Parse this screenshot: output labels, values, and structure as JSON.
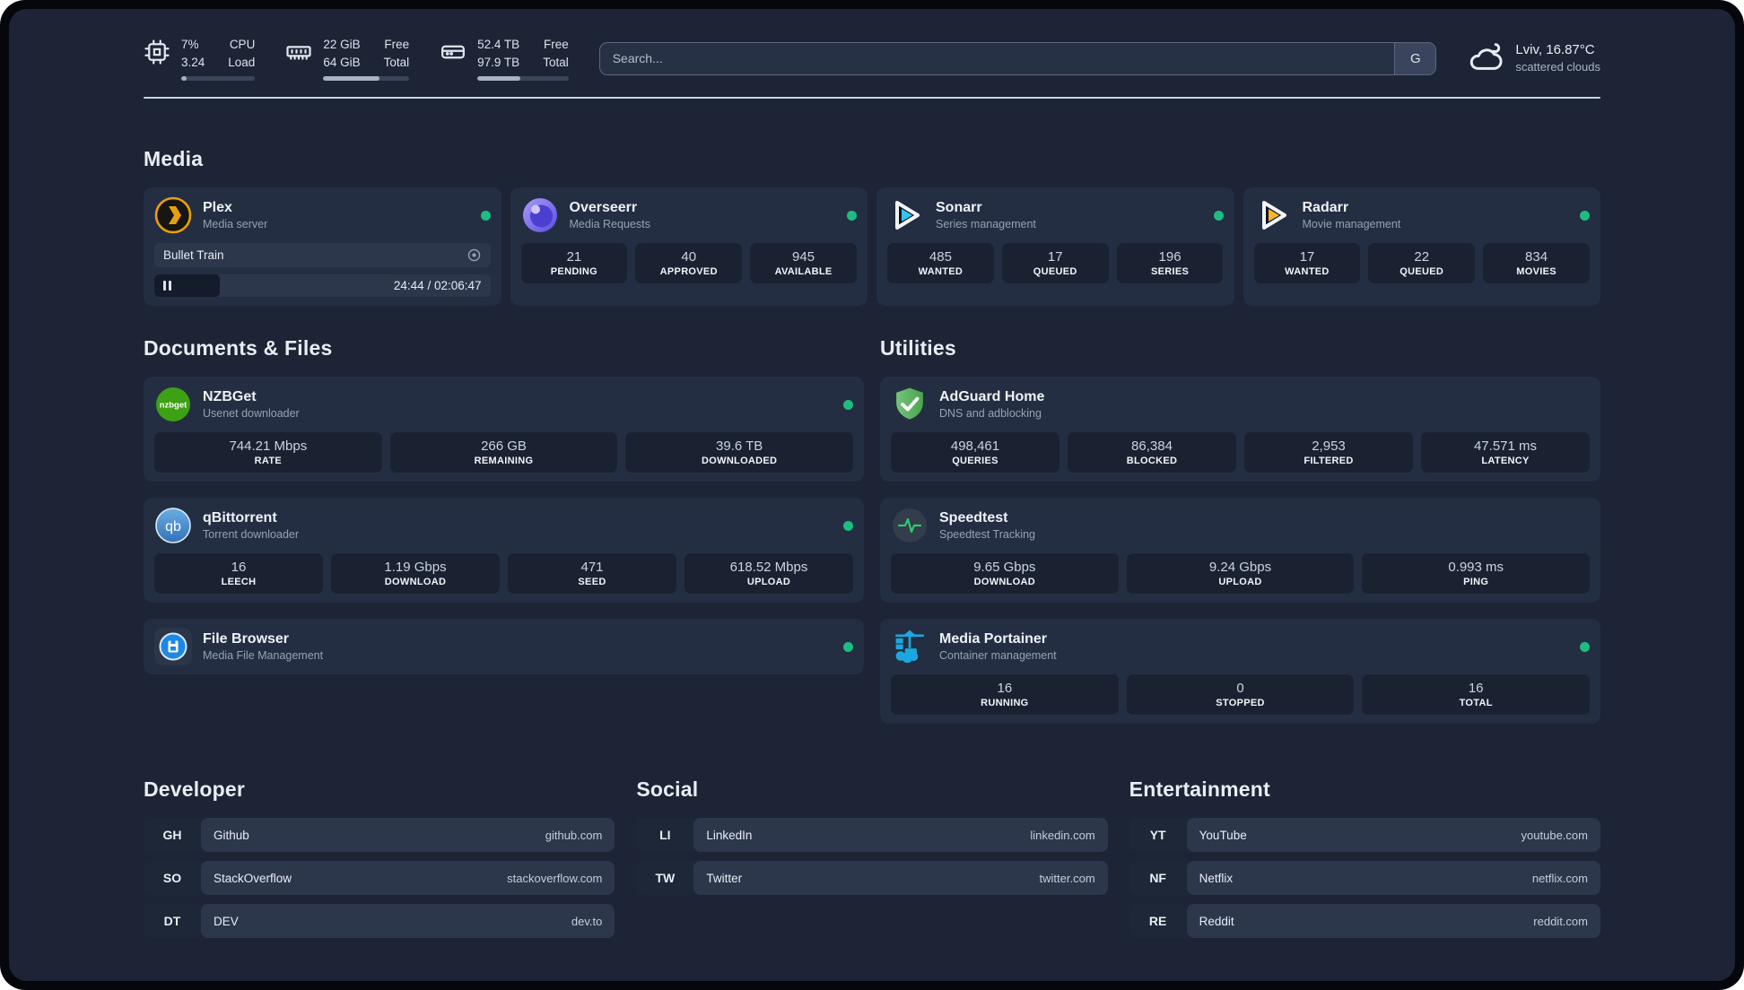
{
  "theme": {
    "background": "#1c2435",
    "card": "#242e42",
    "stat_box": "#1a2232",
    "status_online": "#1dbd82",
    "divider": "#cbd4df",
    "plex_accent": "#e5a00d",
    "sonarr_accent": "#35c5f4",
    "radarr_accent": "#ffb528",
    "adguard_accent": "#5bb85f",
    "portainer_accent": "#1ba8e0"
  },
  "header": {
    "stats": [
      {
        "name": "cpu",
        "values": [
          "7%",
          "3.24"
        ],
        "labels": [
          "CPU",
          "Load"
        ],
        "progress_pct": 7
      },
      {
        "name": "memory",
        "values": [
          "22 GiB",
          "64 GiB"
        ],
        "labels": [
          "Free",
          "Total"
        ],
        "progress_pct": 65
      },
      {
        "name": "disk",
        "values": [
          "52.4 TB",
          "97.9 TB"
        ],
        "labels": [
          "Free",
          "Total"
        ],
        "progress_pct": 47
      }
    ],
    "search": {
      "placeholder": "Search...",
      "provider_button": "G"
    },
    "weather": {
      "location_temp": "Lviv, 16.87°C",
      "condition": "scattered clouds"
    }
  },
  "media": {
    "title": "Media",
    "plex": {
      "title": "Plex",
      "subtitle": "Media server",
      "online": true,
      "now_playing": {
        "title": "Bullet Train",
        "time_display": "24:44 / 02:06:47",
        "progress_pct": 19.5,
        "state": "paused"
      }
    },
    "overseerr": {
      "title": "Overseerr",
      "subtitle": "Media Requests",
      "online": true,
      "stats": [
        {
          "value": "21",
          "label": "PENDING"
        },
        {
          "value": "40",
          "label": "APPROVED"
        },
        {
          "value": "945",
          "label": "AVAILABLE"
        }
      ]
    },
    "sonarr": {
      "title": "Sonarr",
      "subtitle": "Series management",
      "online": true,
      "stats": [
        {
          "value": "485",
          "label": "WANTED"
        },
        {
          "value": "17",
          "label": "QUEUED"
        },
        {
          "value": "196",
          "label": "SERIES"
        }
      ]
    },
    "radarr": {
      "title": "Radarr",
      "subtitle": "Movie management",
      "online": true,
      "stats": [
        {
          "value": "17",
          "label": "WANTED"
        },
        {
          "value": "22",
          "label": "QUEUED"
        },
        {
          "value": "834",
          "label": "MOVIES"
        }
      ]
    }
  },
  "documents": {
    "title": "Documents & Files",
    "nzbget": {
      "title": "NZBGet",
      "subtitle": "Usenet downloader",
      "online": true,
      "icon_text": "nzbget",
      "stats": [
        {
          "value": "744.21 Mbps",
          "label": "RATE"
        },
        {
          "value": "266 GB",
          "label": "REMAINING"
        },
        {
          "value": "39.6 TB",
          "label": "DOWNLOADED"
        }
      ]
    },
    "qbittorrent": {
      "title": "qBittorrent",
      "subtitle": "Torrent downloader",
      "online": true,
      "icon_text": "qb",
      "stats": [
        {
          "value": "16",
          "label": "LEECH"
        },
        {
          "value": "1.19 Gbps",
          "label": "DOWNLOAD"
        },
        {
          "value": "471",
          "label": "SEED"
        },
        {
          "value": "618.52 Mbps",
          "label": "UPLOAD"
        }
      ]
    },
    "filebrowser": {
      "title": "File Browser",
      "subtitle": "Media File Management",
      "online": true
    }
  },
  "utilities": {
    "title": "Utilities",
    "adguard": {
      "title": "AdGuard Home",
      "subtitle": "DNS and adblocking",
      "stats": [
        {
          "value": "498,461",
          "label": "QUERIES"
        },
        {
          "value": "86,384",
          "label": "BLOCKED"
        },
        {
          "value": "2,953",
          "label": "FILTERED"
        },
        {
          "value": "47.571 ms",
          "label": "LATENCY"
        }
      ]
    },
    "speedtest": {
      "title": "Speedtest",
      "subtitle": "Speedtest Tracking",
      "stats": [
        {
          "value": "9.65 Gbps",
          "label": "DOWNLOAD"
        },
        {
          "value": "9.24 Gbps",
          "label": "UPLOAD"
        },
        {
          "value": "0.993 ms",
          "label": "PING"
        }
      ]
    },
    "portainer": {
      "title": "Media Portainer",
      "subtitle": "Container management",
      "online": true,
      "stats": [
        {
          "value": "16",
          "label": "RUNNING"
        },
        {
          "value": "0",
          "label": "STOPPED"
        },
        {
          "value": "16",
          "label": "TOTAL"
        }
      ]
    }
  },
  "bookmarks": [
    {
      "title": "Developer",
      "links": [
        {
          "abbr": "GH",
          "name": "Github",
          "domain": "github.com"
        },
        {
          "abbr": "SO",
          "name": "StackOverflow",
          "domain": "stackoverflow.com"
        },
        {
          "abbr": "DT",
          "name": "DEV",
          "domain": "dev.to"
        }
      ]
    },
    {
      "title": "Social",
      "links": [
        {
          "abbr": "LI",
          "name": "LinkedIn",
          "domain": "linkedin.com"
        },
        {
          "abbr": "TW",
          "name": "Twitter",
          "domain": "twitter.com"
        }
      ]
    },
    {
      "title": "Entertainment",
      "links": [
        {
          "abbr": "YT",
          "name": "YouTube",
          "domain": "youtube.com"
        },
        {
          "abbr": "NF",
          "name": "Netflix",
          "domain": "netflix.com"
        },
        {
          "abbr": "RE",
          "name": "Reddit",
          "domain": "reddit.com"
        }
      ]
    }
  ]
}
